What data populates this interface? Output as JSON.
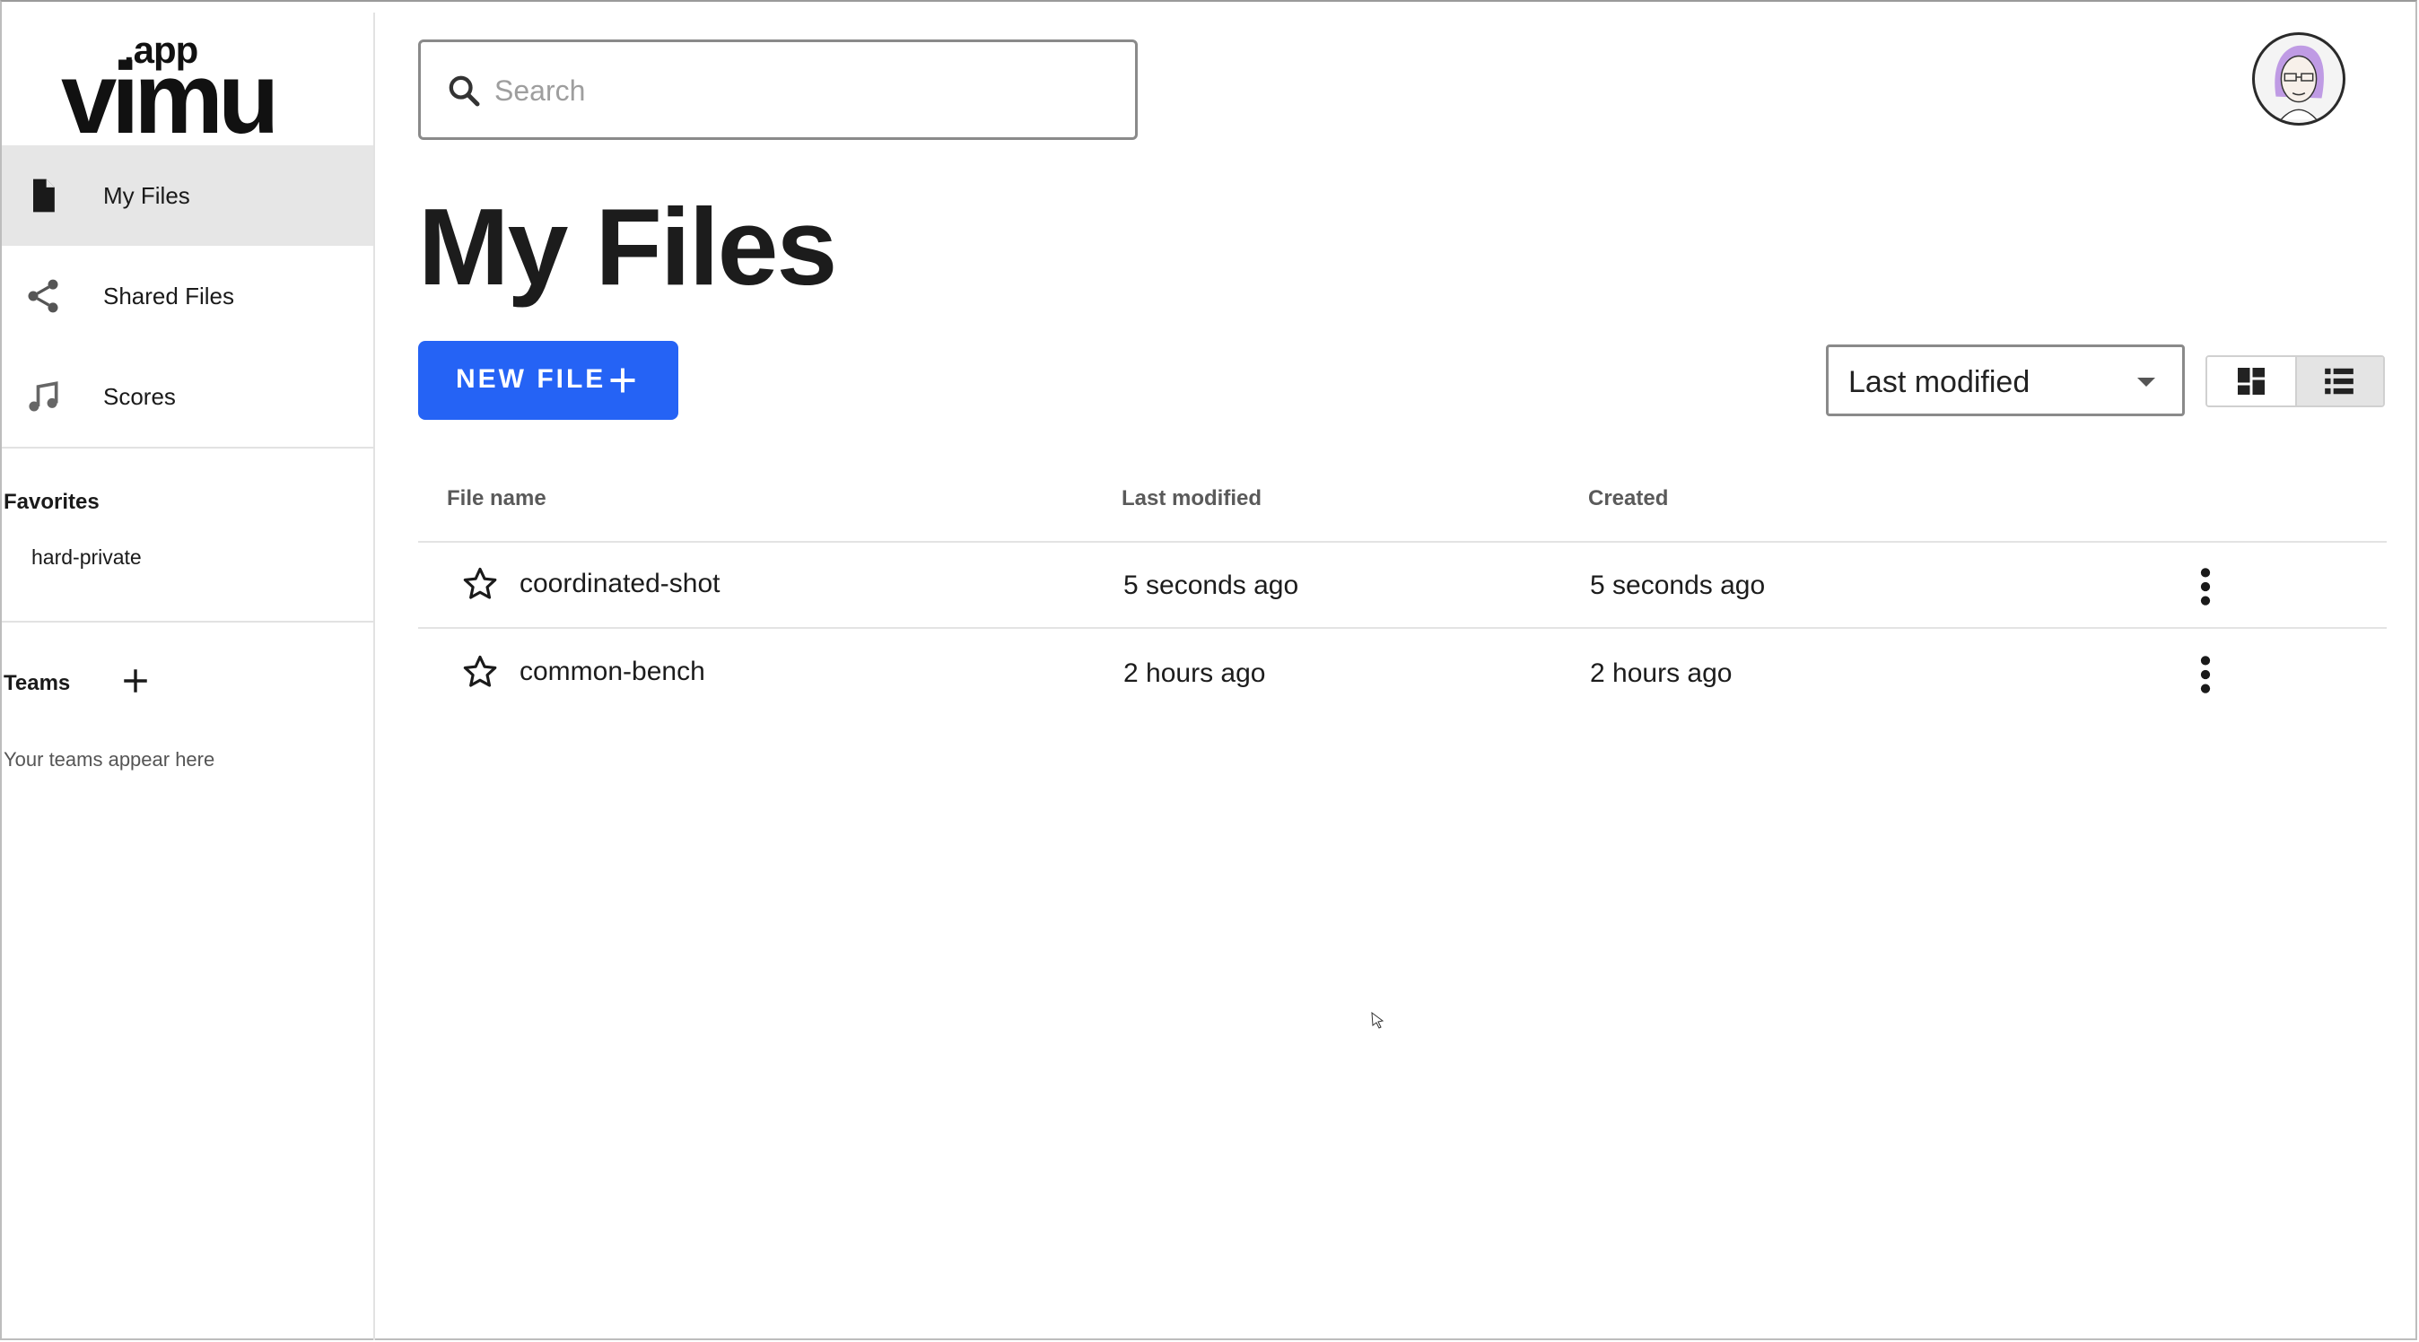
{
  "logo": {
    "app": ".app",
    "brand": "vimu"
  },
  "sidebar": {
    "items": [
      {
        "label": "My Files",
        "icon": "file-icon",
        "active": true
      },
      {
        "label": "Shared Files",
        "icon": "share-icon",
        "active": false
      },
      {
        "label": "Scores",
        "icon": "music-note-icon",
        "active": false
      }
    ],
    "favorites_title": "Favorites",
    "favorites": [
      "hard-private"
    ],
    "teams_title": "Teams",
    "teams_hint": "Your teams appear here"
  },
  "search": {
    "placeholder": "Search",
    "value": ""
  },
  "page": {
    "title": "My Files"
  },
  "toolbar": {
    "new_file_label": "NEW FILE",
    "sort_value": "Last modified",
    "view_mode": "list"
  },
  "table": {
    "headers": {
      "name": "File name",
      "modified": "Last modified",
      "created": "Created"
    },
    "rows": [
      {
        "name": "coordinated-shot",
        "modified": "5 seconds ago",
        "created": "5 seconds ago"
      },
      {
        "name": "common-bench",
        "modified": "2 hours ago",
        "created": "2 hours ago"
      }
    ]
  },
  "colors": {
    "accent": "#2563f5",
    "active_bg": "#e6e6e6",
    "avatar_hair": "#b58be0"
  }
}
